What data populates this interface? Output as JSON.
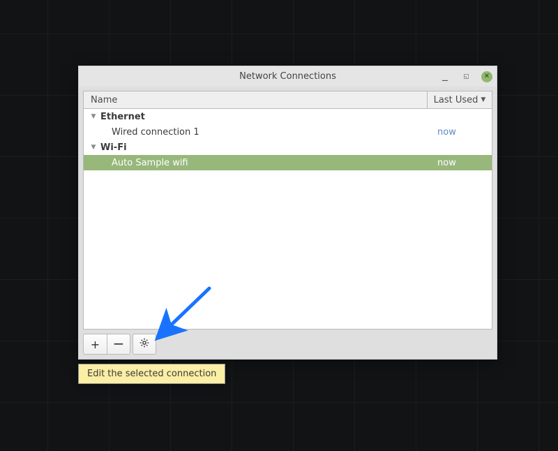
{
  "window": {
    "title": "Network Connections"
  },
  "columns": {
    "name": "Name",
    "last_used": "Last Used"
  },
  "groups": [
    {
      "label": "Ethernet",
      "items": [
        {
          "label": "Wired connection 1",
          "last_used": "now",
          "selected": false
        }
      ]
    },
    {
      "label": "Wi-Fi",
      "items": [
        {
          "label": "Auto Sample wifi",
          "last_used": "now",
          "selected": true
        }
      ]
    }
  ],
  "toolbar": {
    "add": "+",
    "remove": "−",
    "settings_icon": "gear-icon"
  },
  "tooltip": {
    "text": "Edit the selected connection"
  }
}
